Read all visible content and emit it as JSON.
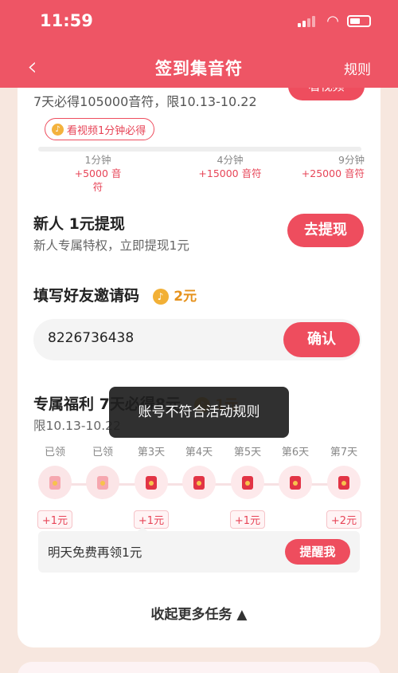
{
  "status_bar": {
    "time": "11:59"
  },
  "nav": {
    "back": "‹",
    "title": "签到集音符",
    "rules": "规则"
  },
  "video_task": {
    "subtitle": "7天必得105000音符，限10.13-10.22",
    "button": "看视频",
    "tip": "看视频1分钟必得",
    "milestones": [
      {
        "time": "1分钟",
        "reward": "+5000 音符"
      },
      {
        "time": "4分钟",
        "reward": "+15000 音符"
      },
      {
        "time": "9分钟",
        "reward": "+25000 音符"
      }
    ]
  },
  "new_user": {
    "title": "新人 1元提现",
    "subtitle": "新人专属特权，立即提现1元",
    "button": "去提现"
  },
  "invite": {
    "title": "填写好友邀请码",
    "reward": "2元",
    "code": "8226736438",
    "button": "确认"
  },
  "welfare": {
    "title": "专属福利 7天必得8元",
    "reward": "1元",
    "subtitle": "限10.13-10.22",
    "days": [
      {
        "label": "已领",
        "reward": "+1元"
      },
      {
        "label": "已领",
        "reward": ""
      },
      {
        "label": "第3天",
        "reward": "+1元"
      },
      {
        "label": "第4天",
        "reward": ""
      },
      {
        "label": "第5天",
        "reward": "+1元"
      },
      {
        "label": "第6天",
        "reward": ""
      },
      {
        "label": "第7天",
        "reward": "+2元"
      }
    ],
    "remind_text": "明天免费再领1元",
    "remind_button": "提醒我"
  },
  "collapse": "收起更多任务 ▲",
  "toast": "账号不符合活动规则"
}
